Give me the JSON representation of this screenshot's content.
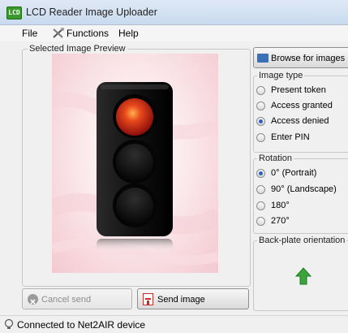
{
  "window": {
    "title": "LCD Reader Image Uploader",
    "app_icon_text": "LCD"
  },
  "menu": [
    "File",
    "Functions",
    "Help"
  ],
  "preview": {
    "legend": "Selected Image Preview"
  },
  "buttons": {
    "cancel_send": "Cancel send",
    "send_image": "Send image",
    "browse": "Browse for images"
  },
  "image_type": {
    "legend": "Image type",
    "options": [
      "Present token",
      "Access granted",
      "Access denied",
      "Enter PIN"
    ],
    "selected": "Access denied"
  },
  "rotation": {
    "legend": "Rotation",
    "options": [
      "0° (Portrait)",
      "90° (Landscape)",
      "180°",
      "270°"
    ],
    "selected": "0° (Portrait)"
  },
  "back_plate": {
    "legend": "Back-plate orientation"
  },
  "status": {
    "text": "Connected to Net2AIR device"
  },
  "colors": {
    "arrow": "#3aa53a",
    "red_light": "#e0231b"
  }
}
